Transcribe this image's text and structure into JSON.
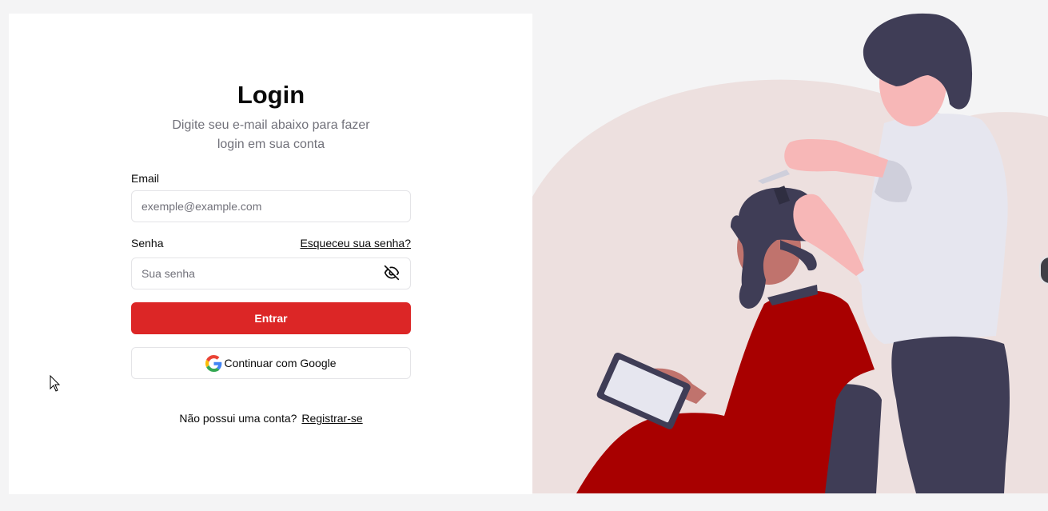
{
  "login": {
    "title": "Login",
    "subtitle": "Digite seu e-mail abaixo para fazer login em sua conta",
    "email_label": "Email",
    "email_placeholder": "exemple@example.com",
    "email_value": "",
    "password_label": "Senha",
    "password_placeholder": "Sua senha",
    "password_value": "",
    "forgot_link": "Esqueceu sua senha?",
    "submit_label": "Entrar",
    "google_label": "Continuar com Google",
    "no_account_text": "Não possui uma conta?",
    "register_link": "Registrar-se"
  },
  "icons": {
    "password_toggle": "eye-off-icon",
    "google": "google-icon"
  },
  "colors": {
    "accent": "#dc2626",
    "text": "#0a0a0a",
    "muted": "#71717a",
    "border": "#e4e4e7",
    "illustration_backdrop": "#ede0df",
    "illustration_cape": "#a80000",
    "illustration_dark": "#3f3d56"
  }
}
